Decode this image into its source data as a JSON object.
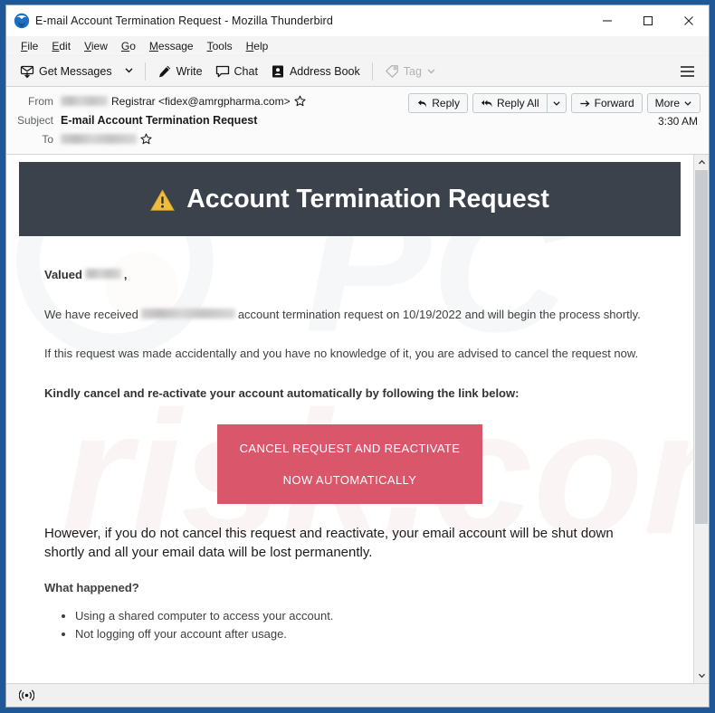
{
  "window": {
    "title": "E-mail Account Termination Request - Mozilla Thunderbird",
    "logo_icon": "thunderbird-logo-icon",
    "controls": {
      "minimize": "minimize-icon",
      "maximize": "maximize-icon",
      "close": "close-icon"
    }
  },
  "menubar": {
    "items": [
      {
        "label": "File",
        "accel": "F"
      },
      {
        "label": "Edit",
        "accel": "E"
      },
      {
        "label": "View",
        "accel": "V"
      },
      {
        "label": "Go",
        "accel": "G"
      },
      {
        "label": "Message",
        "accel": "M"
      },
      {
        "label": "Tools",
        "accel": "T"
      },
      {
        "label": "Help",
        "accel": "H"
      }
    ]
  },
  "toolbar": {
    "get_messages": "Get Messages",
    "write": "Write",
    "chat": "Chat",
    "address_book": "Address Book",
    "tag": "Tag",
    "tag_disabled": true,
    "menu_icon": "hamburger-menu-icon"
  },
  "message_header": {
    "from_label": "From",
    "from_redacted": true,
    "from_value": "Registrar <fidex@amrgpharma.com>",
    "subject_label": "Subject",
    "subject_value": "E-mail Account Termination Request",
    "to_label": "To",
    "to_redacted": true,
    "time": "3:30 AM",
    "actions": {
      "reply": "Reply",
      "reply_all": "Reply All",
      "forward": "Forward",
      "more": "More"
    }
  },
  "email": {
    "banner": {
      "icon": "warning-triangle-icon",
      "title": "Account Termination Request",
      "background_color": "#3b424c",
      "icon_color": "#f0bc3e"
    },
    "greeting_prefix": "Valued",
    "greeting_suffix": ",",
    "paragraph_1_before": "We have received",
    "paragraph_1_after": "account termination request on 10/19/2022 and will begin the process shortly.",
    "termination_date": "10/19/2022",
    "paragraph_2": "If this request was made accidentally and you have no knowledge of it, you are advised to cancel the request now.",
    "paragraph_3": "Kindly cancel and re-activate your account automatically by following the link below:",
    "cta_line_1": "CANCEL REQUEST AND REACTIVATE",
    "cta_line_2": "NOW AUTOMATICALLY",
    "cta_color": "#d9566b",
    "warning_paragraph": "However, if you do not cancel this request and reactivate, your email account will be shut down shortly and all your email data will be lost permanently.",
    "what_happened_heading": "What happened?",
    "reasons": [
      "Using a shared computer to access your account.",
      "Not logging off your account after usage."
    ],
    "watermark_text": "pcrisk.com"
  },
  "scrollbar": {
    "up_icon": "chevron-up-icon",
    "down_icon": "chevron-down-icon"
  },
  "statusbar": {
    "icon": "broadcast-icon"
  }
}
